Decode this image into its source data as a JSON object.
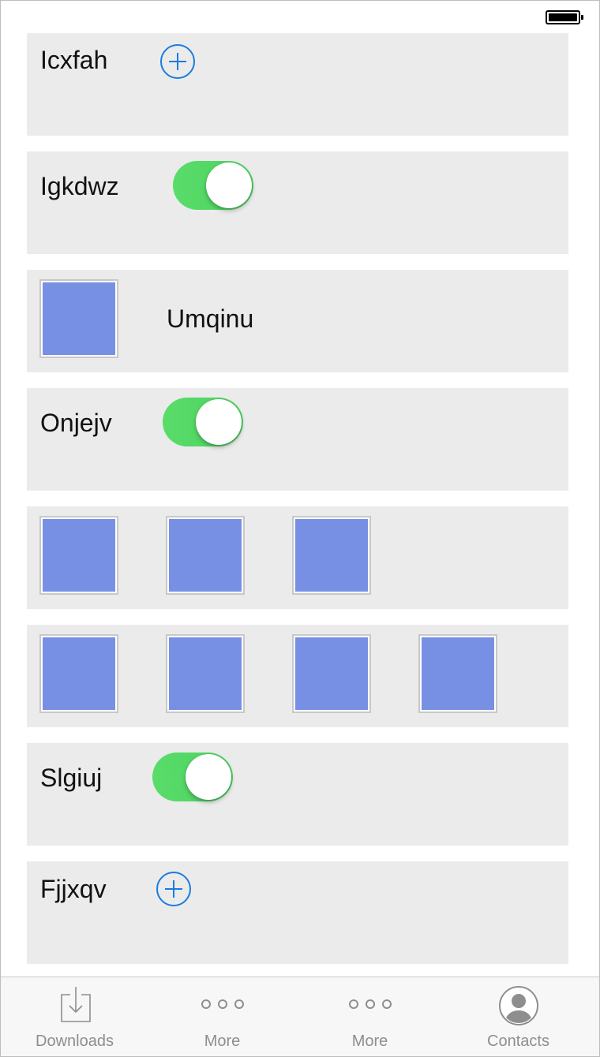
{
  "status_bar": {
    "battery": "full"
  },
  "rows": [
    {
      "type": "label-plus",
      "label": "Icxfah"
    },
    {
      "type": "label-toggle",
      "label": "Igkdwz",
      "toggle_on": true
    },
    {
      "type": "image-label",
      "label": "Umqinu"
    },
    {
      "type": "label-toggle",
      "label": "Onjejv",
      "toggle_on": true
    },
    {
      "type": "images",
      "count": 3
    },
    {
      "type": "images",
      "count": 4
    },
    {
      "type": "label-toggle",
      "label": "Slgiuj",
      "toggle_on": true
    },
    {
      "type": "label-plus",
      "label": "Fjjxqv"
    }
  ],
  "tabbar": {
    "tabs": [
      {
        "label": "Downloads",
        "icon": "download-icon"
      },
      {
        "label": "More",
        "icon": "more-icon"
      },
      {
        "label": "More",
        "icon": "more-icon"
      },
      {
        "label": "Contacts",
        "icon": "contact-icon"
      }
    ]
  },
  "colors": {
    "row_bg": "#ebebeb",
    "accent_blue": "#1a7be0",
    "toggle_green": "#4cd35f",
    "thumb_fill": "#7790e4",
    "tab_gray": "#8e8e8e"
  }
}
